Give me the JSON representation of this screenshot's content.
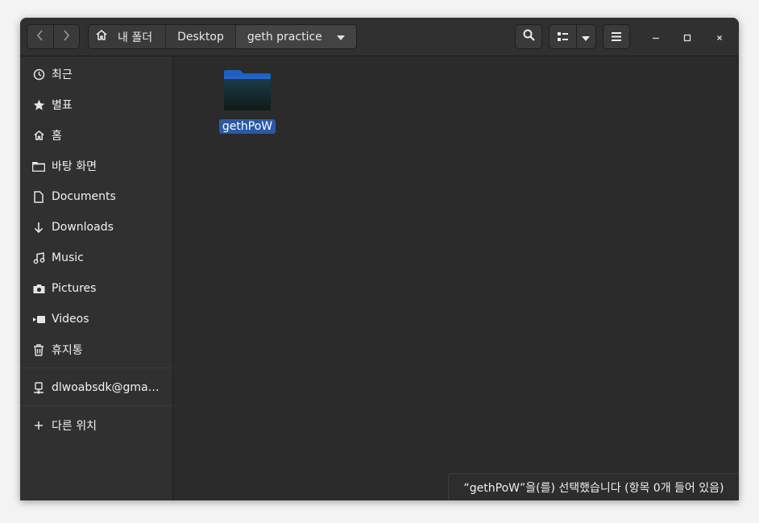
{
  "pathbar": {
    "home_label": "내 폴더",
    "crumbs": [
      "Desktop",
      "geth practice"
    ]
  },
  "icons": {
    "back": "chevron-left-icon",
    "forward": "chevron-right-icon",
    "home": "home-icon",
    "dropdown": "triangle-down-icon",
    "search": "search-icon",
    "view": "list-view-icon",
    "menu": "hamburger-menu-icon",
    "minimize": "minimize-icon",
    "maximize": "maximize-icon",
    "close": "close-icon"
  },
  "sidebar": {
    "items": [
      {
        "label": "최근",
        "icon": "clock-icon"
      },
      {
        "label": "별표",
        "icon": "star-icon"
      },
      {
        "label": "홈",
        "icon": "home-icon"
      },
      {
        "label": "바탕 화면",
        "icon": "folder-icon"
      },
      {
        "label": "Documents",
        "icon": "document-icon"
      },
      {
        "label": "Downloads",
        "icon": "download-arrow-icon"
      },
      {
        "label": "Music",
        "icon": "music-note-icon"
      },
      {
        "label": "Pictures",
        "icon": "camera-icon"
      },
      {
        "label": "Videos",
        "icon": "video-icon"
      },
      {
        "label": "휴지통",
        "icon": "trash-icon"
      }
    ],
    "network_item": {
      "label": "dlwoabsdk@gma…",
      "icon": "network-drive-icon"
    },
    "other_locations": {
      "label": "다른 위치",
      "icon": "plus-icon"
    }
  },
  "files": [
    {
      "name": "gethPoW",
      "type": "folder",
      "selected": true
    }
  ],
  "status_text": "“gethPoW”을(를) 선택했습니다  (항목 0개 들어 있음)",
  "colors": {
    "selection": "#2a5aa6",
    "folder": "#1e5fc4",
    "window_bg": "#2b2b2b",
    "sidebar_bg": "#303030"
  }
}
